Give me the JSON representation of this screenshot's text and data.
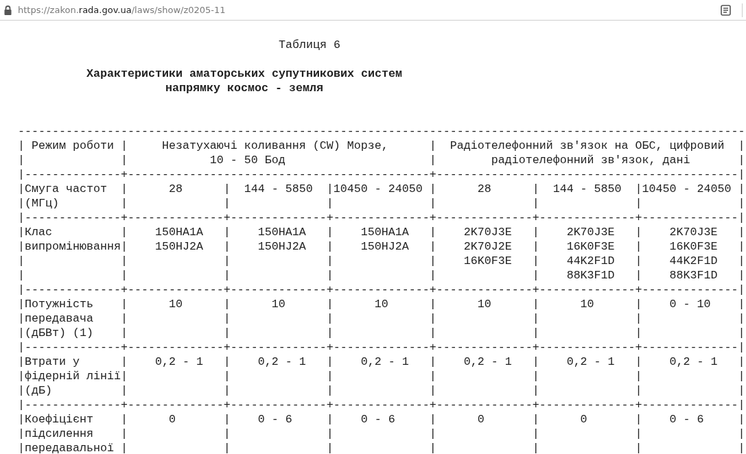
{
  "address_bar": {
    "url_parts": [
      {
        "kind": "scheme",
        "text": "https://zakon."
      },
      {
        "kind": "domain",
        "text": "rada.gov.ua"
      },
      {
        "kind": "path",
        "text": "/laws/show/z0205-11"
      }
    ]
  },
  "table_title": "Таблиця 6",
  "caption": [
    "Характеристики аматорських супутникових систем",
    "напрямку космос - земля"
  ],
  "lines": [
    "----------------------------------------------------------------------------------------------------------",
    "| Режим роботи |     Незатухаючі коливання (CW) Морзе,      |  Радіотелефонний зв'язок на ОБС, цифровий  |",
    "|              |            10 - 50 Бод                     |        радіотелефонний зв'язок, дані       |",
    "|--------------+--------------------------------------------+--------------------------------------------|",
    "|Смуга частот  |      28      |  144 - 5850  |10450 - 24050 |      28      |  144 - 5850  |10450 - 24050 |",
    "|(МГц)         |              |              |              |              |              |              |",
    "|--------------+--------------+--------------+--------------+--------------+--------------+--------------|",
    "|Клас          |    150HA1A   |    150HA1A   |    150HA1A   |    2K70J3E   |    2K70J3E   |    2K70J3E   |",
    "|випромінювання|    150HJ2A   |    150HJ2A   |    150HJ2A   |    2K70J2E   |    16K0F3E   |    16K0F3E   |",
    "|              |              |              |              |    16K0F3E   |    44K2F1D   |    44K2F1D   |",
    "|              |              |              |              |              |    88K3F1D   |    88K3F1D   |",
    "|--------------+--------------+--------------+--------------+--------------+--------------+--------------|",
    "|Потужність    |      10      |      10      |      10      |      10      |      10      |    0 - 10    |",
    "|передавача    |              |              |              |              |              |              |",
    "|(дБВт) (1)    |              |              |              |              |              |              |",
    "|--------------+--------------+--------------+--------------+--------------+--------------+--------------|",
    "|Втрати у      |    0,2 - 1   |    0,2 - 1   |    0,2 - 1   |    0,2 - 1   |    0,2 - 1   |    0,2 - 1   |",
    "|фідерній лінії|              |              |              |              |              |              |",
    "|(дБ)          |              |              |              |              |              |              |",
    "|--------------+--------------+--------------+--------------+--------------+--------------+--------------|",
    "|Коефіцієнт    |      0       |    0 - 6     |    0 - 6     |      0       |      0       |    0 - 6     |",
    "|підсилення    |              |              |              |              |              |              |",
    "|передавальної |              |              |              |              |              |              |"
  ]
}
